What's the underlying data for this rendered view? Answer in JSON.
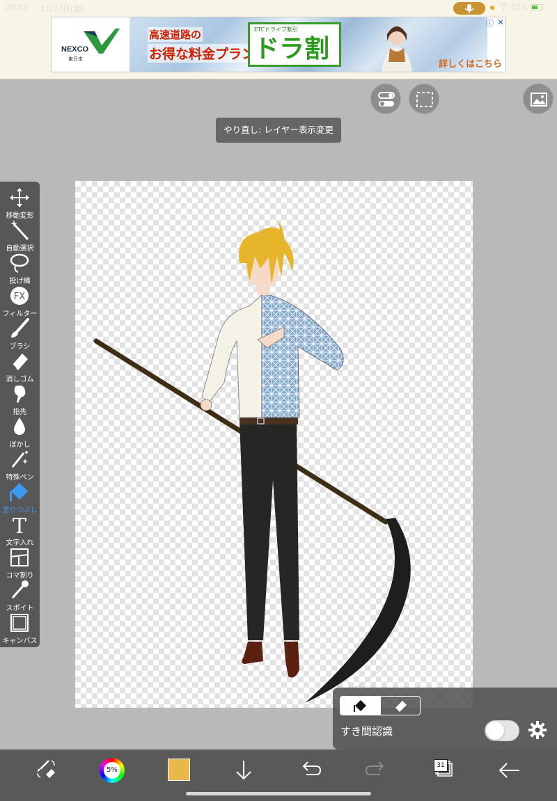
{
  "status_bar": {
    "time": "20:53",
    "date": "1月27日(金)",
    "battery": "51%"
  },
  "ad": {
    "brand": "NEXCO",
    "brand_sub": "東日本",
    "line1": "高速道路の",
    "line2": "お得な料金プラン",
    "etc_small": "ETCドライブ割引",
    "product": "ドラ割",
    "cta": "詳しくはこちら",
    "info": "ⓘ",
    "close": "✕"
  },
  "toast": {
    "message": "やり直し: レイヤー表示変更"
  },
  "toolbar": {
    "items": [
      {
        "label": "移動変形",
        "icon": "move-icon"
      },
      {
        "label": "自動選択",
        "icon": "magic-wand-icon"
      },
      {
        "label": "投げ縄",
        "icon": "lasso-icon"
      },
      {
        "label": "フィルター",
        "icon": "fx-icon"
      },
      {
        "label": "ブラシ",
        "icon": "brush-icon"
      },
      {
        "label": "消しゴム",
        "icon": "eraser-icon"
      },
      {
        "label": "指先",
        "icon": "smudge-icon"
      },
      {
        "label": "ぼかし",
        "icon": "blur-drop-icon"
      },
      {
        "label": "特殊ペン",
        "icon": "special-pen-icon"
      },
      {
        "label": "塗りつぶし",
        "icon": "fill-bucket-icon",
        "active": true
      },
      {
        "label": "文字入れ",
        "icon": "text-icon"
      },
      {
        "label": "コマ割り",
        "icon": "panel-divide-icon"
      },
      {
        "label": "スポイト",
        "icon": "eyedropper-icon"
      },
      {
        "label": "キャンバス",
        "icon": "canvas-icon"
      }
    ],
    "fx_text": "FX",
    "text_glyph": "T"
  },
  "fill_panel": {
    "gap_label": "すき間認識",
    "gap_toggle": false
  },
  "bottom_bar": {
    "color_wheel_text": "5%",
    "current_color": "#e8b84a",
    "layer_count": "31"
  },
  "colors": {
    "accent": "#3d9af0",
    "toolbar_bg": "#575757",
    "bottom_bg": "#595959"
  }
}
